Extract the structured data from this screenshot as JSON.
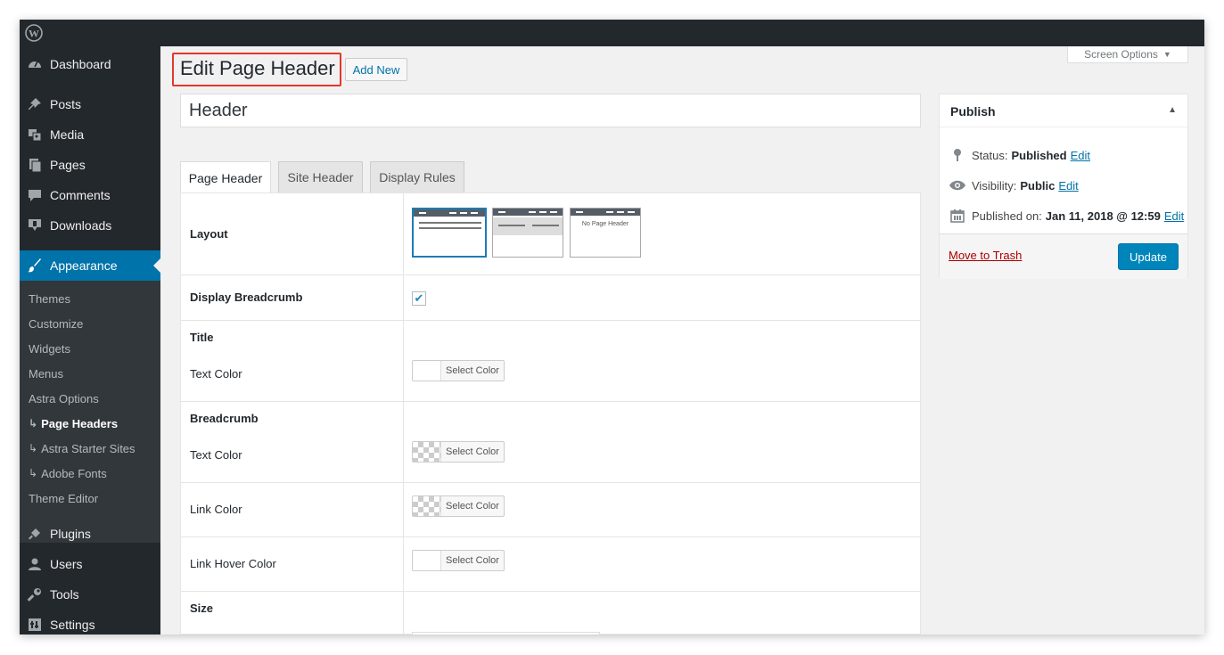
{
  "sidebar": {
    "items": [
      {
        "label": "Dashboard",
        "icon": "dashboard-icon"
      },
      {
        "label": "Posts",
        "icon": "pin-icon"
      },
      {
        "label": "Media",
        "icon": "media-icon"
      },
      {
        "label": "Pages",
        "icon": "pages-icon"
      },
      {
        "label": "Comments",
        "icon": "comment-icon"
      },
      {
        "label": "Downloads",
        "icon": "download-icon"
      },
      {
        "label": "Appearance",
        "icon": "brush-icon"
      },
      {
        "label": "Plugins",
        "icon": "plug-icon"
      },
      {
        "label": "Users",
        "icon": "user-icon"
      },
      {
        "label": "Tools",
        "icon": "wrench-icon"
      },
      {
        "label": "Settings",
        "icon": "settings-icon"
      }
    ],
    "submenu": [
      {
        "label": "Themes"
      },
      {
        "label": "Customize"
      },
      {
        "label": "Widgets"
      },
      {
        "label": "Menus"
      },
      {
        "label": "Astra Options"
      },
      {
        "label": "Page Headers"
      },
      {
        "label": "Astra Starter Sites"
      },
      {
        "label": "Adobe Fonts"
      },
      {
        "label": "Theme Editor"
      }
    ]
  },
  "header": {
    "screen_options": "Screen Options",
    "title": "Edit Page Header",
    "add_new": "Add New"
  },
  "post_title": "Header",
  "tabs": [
    {
      "label": "Page Header"
    },
    {
      "label": "Site Header"
    },
    {
      "label": "Display Rules"
    }
  ],
  "settings": {
    "layout_label": "Layout",
    "no_page_header": "No Page Header",
    "display_breadcrumb_label": "Display Breadcrumb",
    "display_breadcrumb_checked": true,
    "title_section": "Title",
    "title_text_color": "Text Color",
    "breadcrumb_section": "Breadcrumb",
    "breadcrumb_text_color": "Text Color",
    "breadcrumb_link_color": "Link Color",
    "breadcrumb_link_hover_color": "Link Hover Color",
    "size_section": "Size",
    "select_color": "Select Color"
  },
  "publish": {
    "title": "Publish",
    "status_label": "Status:",
    "status_value": "Published",
    "visibility_label": "Visibility:",
    "visibility_value": "Public",
    "published_label": "Published on:",
    "published_value": "Jan 11, 2018 @ 12:59",
    "edit": "Edit",
    "move_to_trash": "Move to Trash",
    "update": "Update"
  },
  "colors": {
    "admin_dark": "#23282d",
    "accent": "#0073aa",
    "highlight_box": "#e2372a",
    "update_button": "#0085ba"
  }
}
